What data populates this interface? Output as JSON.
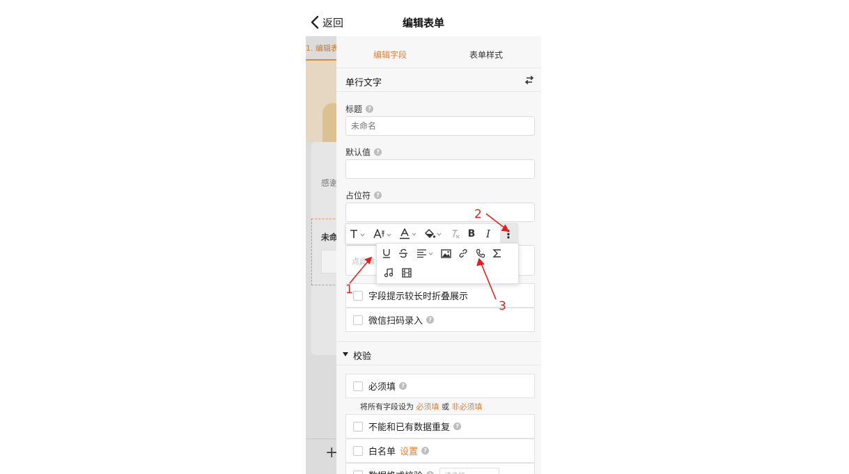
{
  "navbar": {
    "back_label": "返回",
    "title": "编辑表单"
  },
  "background": {
    "tab_label": "1. 编辑表",
    "text1": "感谢",
    "text2": "未命",
    "plus": "+"
  },
  "panel": {
    "tabs": [
      {
        "label": "编辑字段",
        "active": true
      },
      {
        "label": "表单样式",
        "active": false
      }
    ],
    "field_type": "单行文字",
    "title_label": "标题",
    "title_placeholder": "未命名",
    "default_label": "默认值",
    "placeholder_label": "占位符",
    "rich_placeholder": "点此输",
    "checks": [
      "字段提示较长时折叠展示",
      "微信扫码录入"
    ],
    "validation": {
      "section_title": "校验",
      "required": "必须填",
      "all_fields_prefix": "将所有字段设为",
      "all_required": "必须填",
      "or": "或",
      "all_optional": "非必须填",
      "no_duplicate": "不能和已有数据重复",
      "whitelist": "白名单",
      "whitelist_link": "设置",
      "format_check": "数据格式校验",
      "format_select": "请选择"
    }
  },
  "toolbar": {
    "buttons": [
      "text-style",
      "font-size",
      "font-color",
      "background-color",
      "clear-format",
      "bold",
      "italic",
      "more"
    ],
    "bold_glyph": "B",
    "italic_glyph": "I",
    "more_glyph": "⋮",
    "dropdown": [
      "underline",
      "strikethrough",
      "align",
      "image",
      "link",
      "phone",
      "formula",
      "audio",
      "video"
    ]
  },
  "annotations": {
    "n1": "1",
    "n2": "2",
    "n3": "3",
    "color": "#e02020"
  },
  "colors": {
    "accent": "#d9823a"
  }
}
